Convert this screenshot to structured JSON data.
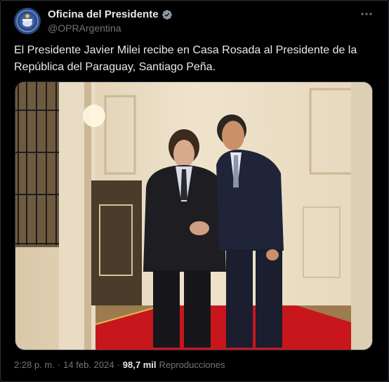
{
  "account": {
    "display_name": "Oficina del Presidente",
    "handle": "@OPRArgentina",
    "verified_icon": "verified-badge-icon",
    "verified_color": "#8b98a5"
  },
  "tweet": {
    "text": "El Presidente Javier Milei recibe en Casa Rosada al Presidente de la República del Paraguay, Santiago Peña."
  },
  "meta": {
    "time": "2:28 p. m.",
    "separator": "·",
    "date": "14 feb. 2024",
    "views_count": "98,7 mil",
    "views_label": "Reproducciones"
  },
  "colors": {
    "background": "#000000",
    "text": "#e7e9ea",
    "secondary": "#71767b",
    "carpet": "#c8161d"
  }
}
